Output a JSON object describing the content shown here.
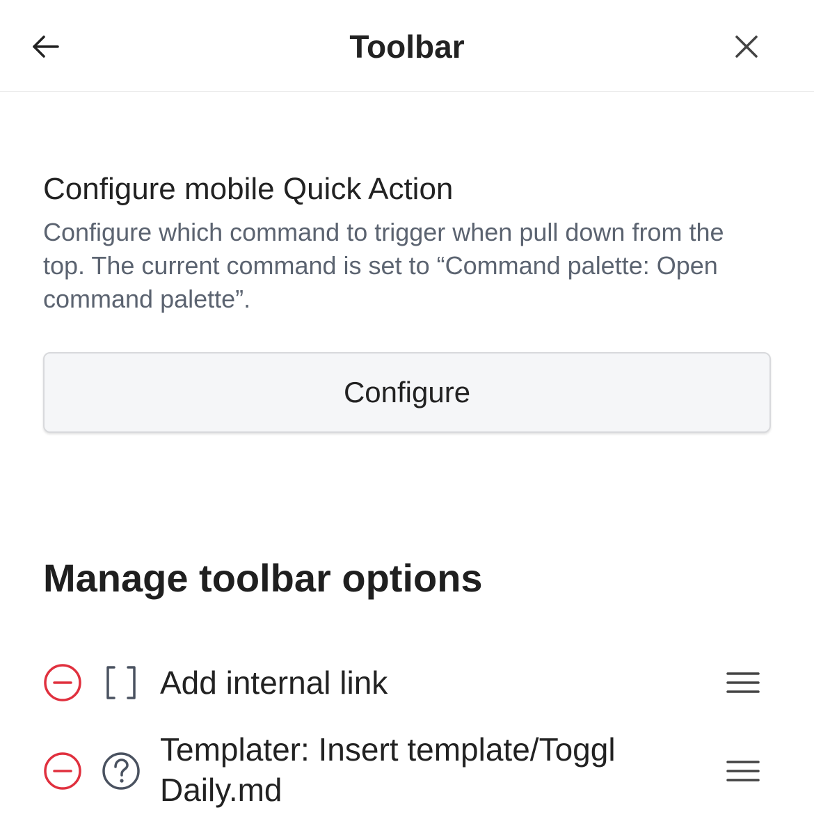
{
  "header": {
    "title": "Toolbar",
    "back_icon": "arrow-left-icon",
    "close_icon": "close-icon"
  },
  "quick_action": {
    "title": "Configure mobile Quick Action",
    "description": "Configure which command to trigger when pull down from the top. The current command is set to “Command palette: Open command palette”.",
    "button_label": "Configure"
  },
  "manage": {
    "title": "Manage toolbar options",
    "items": [
      {
        "label": "Add internal link",
        "icon": "brackets-icon"
      },
      {
        "label": "Templater: Insert template/Toggl Daily.md",
        "icon": "help-circle-icon"
      }
    ]
  },
  "colors": {
    "remove_red": "#e0303e",
    "muted_text": "#5b6370",
    "icon_gray": "#4a5260"
  }
}
